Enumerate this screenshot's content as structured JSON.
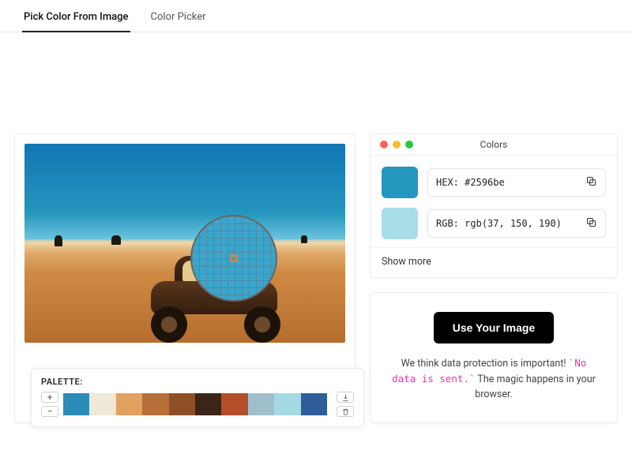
{
  "tabs": {
    "items": [
      {
        "label": "Pick Color From Image",
        "active": true
      },
      {
        "label": "Color Picker",
        "active": false
      }
    ]
  },
  "palette": {
    "title": "PALETTE:",
    "swatches": [
      "#2b8cb8",
      "#eee8d6",
      "#e2a15e",
      "#b76f39",
      "#8e4f28",
      "#3b2518",
      "#b54e2b",
      "#9fbfcd",
      "#a4d8e3",
      "#2e5d99"
    ]
  },
  "selected": {
    "panel_title": "Colors",
    "primary_swatch": "#2596be",
    "secondary_swatch": "#a9dde8",
    "hex_label": "HEX:",
    "hex_value": "#2596be",
    "rgb_label": "RGB:",
    "rgb_value": "rgb(37, 150, 190)",
    "show_more": "Show more"
  },
  "cta": {
    "button": "Use Your Image",
    "line_pre": "We think data protection is important! ",
    "code": "`No data is sent.`",
    "line_post": " The magic happens in your browser."
  }
}
